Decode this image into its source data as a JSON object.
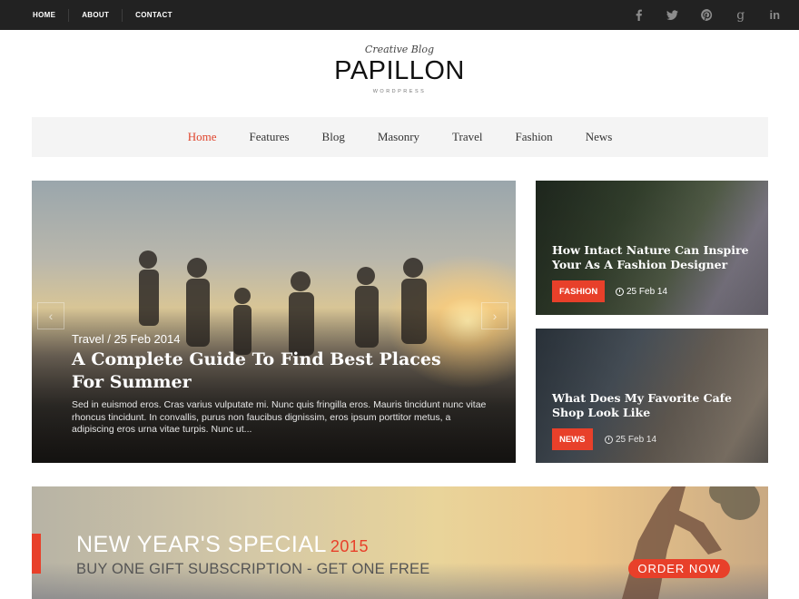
{
  "topbar": {
    "links": [
      "HOME",
      "ABOUT",
      "CONTACT"
    ],
    "social": [
      "facebook-icon",
      "twitter-icon",
      "pinterest-icon",
      "google-plus-icon",
      "linkedin-icon"
    ]
  },
  "logo": {
    "tagline": "Creative Blog",
    "name": "PAPILLON",
    "subtitle": "WORDPRESS"
  },
  "nav": {
    "items": [
      "Home",
      "Features",
      "Blog",
      "Masonry",
      "Travel",
      "Fashion",
      "News"
    ],
    "active": "Home"
  },
  "hero": {
    "meta": "Travel / 25 Feb 2014",
    "title": "A Complete Guide To Find Best Places For Summer",
    "excerpt": "Sed in euismod eros. Cras varius vulputate mi. Nunc quis fringilla eros. Mauris tincidunt nunc vitae rhoncus tincidunt. In convallis, purus non faucibus dignissim, eros ipsum porttitor metus, a adipiscing eros urna vitae turpis. Nunc ut..."
  },
  "cards": [
    {
      "title": "How Intact Nature Can Inspire Your As A Fashion Designer",
      "category": "FASHION",
      "date": "25 Feb 14"
    },
    {
      "title": "What Does My Favorite Cafe Shop Look Like",
      "category": "NEWS",
      "date": "25 Feb 14"
    }
  ],
  "banner": {
    "headline": "NEW YEAR'S SPECIAL",
    "year": "2015",
    "subline": "BUY ONE GIFT SUBSCRIPTION - GET ONE FREE",
    "cta": "ORDER NOW"
  },
  "colors": {
    "accent": "#e8402a",
    "topbar": "#222222",
    "nav_bg": "#f4f4f4"
  }
}
